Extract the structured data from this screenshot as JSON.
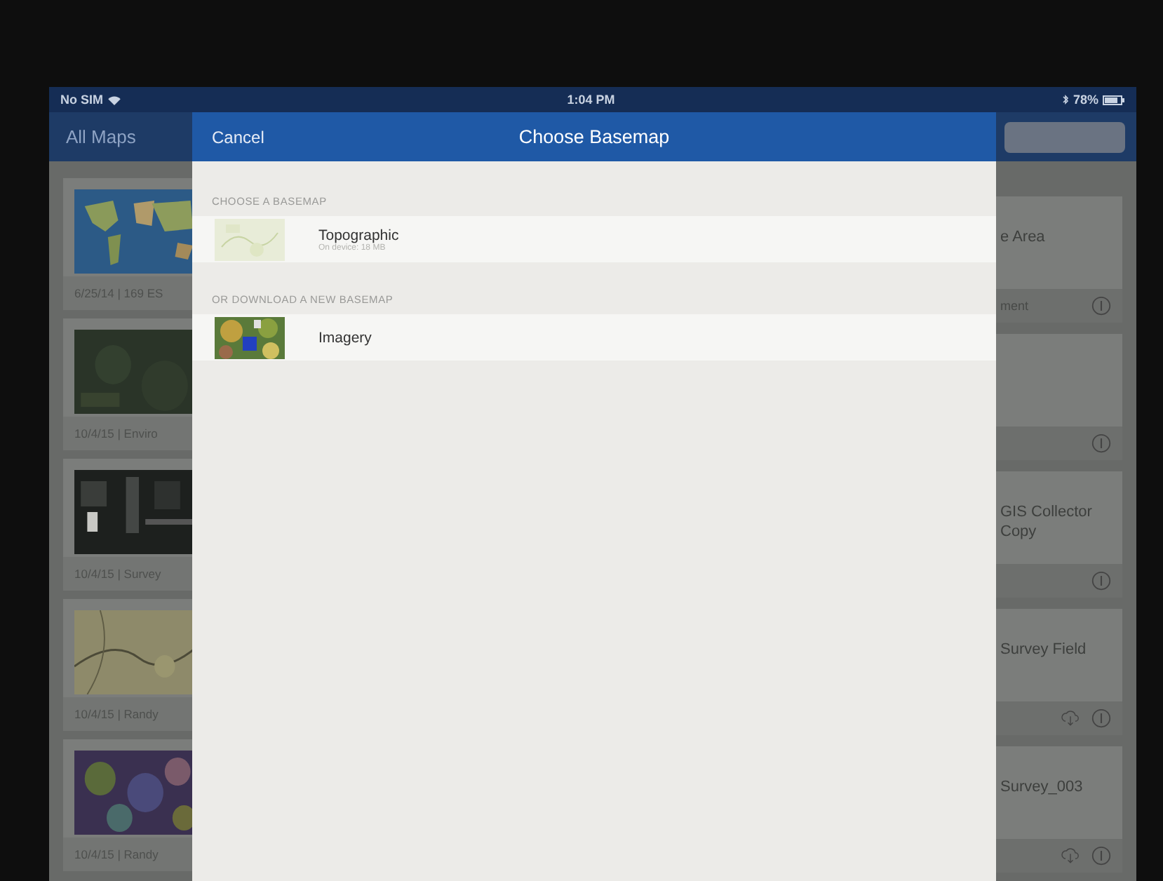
{
  "status_bar": {
    "carrier": "No SIM",
    "time": "1:04 PM",
    "battery": "78%"
  },
  "nav": {
    "back": "All Maps"
  },
  "map_cards_left": [
    {
      "footer": "6/25/14 | 169 ES"
    },
    {
      "footer": "10/4/15 | Enviro"
    },
    {
      "footer": "10/4/15 | Survey"
    },
    {
      "footer": "10/4/15 | Randy"
    },
    {
      "footer": "10/4/15 | Randy"
    }
  ],
  "map_cards_right": [
    {
      "title": "e Area",
      "footer": "ment",
      "downloadable": false
    },
    {
      "downloadable": false
    },
    {
      "title": "GIS Collector Copy",
      "downloadable": false
    },
    {
      "title": "Survey Field",
      "downloadable": true
    },
    {
      "title": "Survey_003",
      "downloadable": true
    }
  ],
  "dialog": {
    "cancel": "Cancel",
    "title": "Choose Basemap",
    "sections": [
      {
        "heading": "CHOOSE A BASEMAP",
        "items": [
          {
            "name": "Topographic",
            "detail": "On device: 18 MB"
          }
        ]
      },
      {
        "heading": "OR DOWNLOAD A NEW BASEMAP",
        "items": [
          {
            "name": "Imagery"
          }
        ]
      }
    ]
  }
}
